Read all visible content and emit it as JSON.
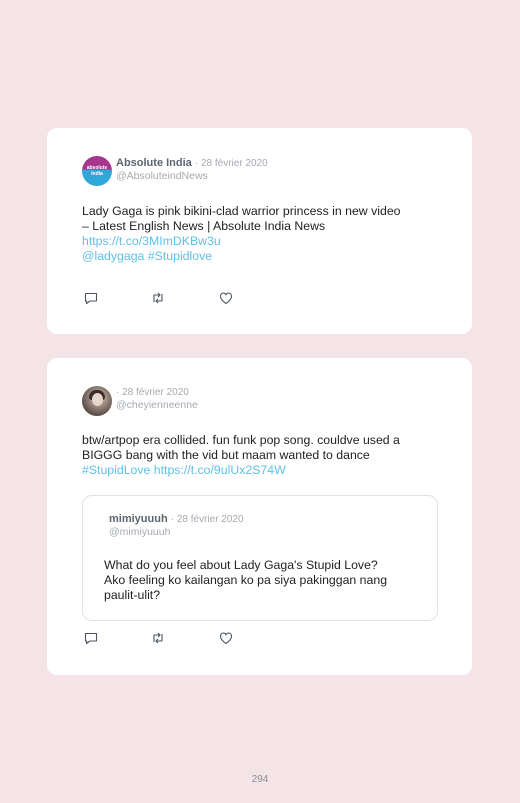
{
  "tweets": [
    {
      "author_name": "Absolute India",
      "date": "· 28 février 2020",
      "handle": "@AbsoluteindNews",
      "avatar_text": "absolute india",
      "lines": [
        "Lady Gaga is pink bikini-clad warrior princess in new video",
        "– Latest English News | Absolute India News"
      ],
      "link": "https://t.co/3MImDKBw3u",
      "tags": "@ladygaga #Stupidlove"
    },
    {
      "author_name": "",
      "date": "· 28 février 2020",
      "handle": "@cheyienneenne",
      "lines": [
        "btw/artpop era collided. fun funk pop song. couldve used a",
        "BIGGG bang with the vid but maam wanted to dance"
      ],
      "tags_link": "#StupidLove https://t.co/9ulUx2S74W",
      "quote": {
        "author_name": "mimiyuuuh",
        "date": "· 28 février 2020",
        "handle": "@mimiyuuuh",
        "lines": [
          "What do you feel about Lady Gaga's Stupid Love?",
          "Ako feeling ko kailangan ko pa siya pakinggan nang",
          "paulit-ulit?"
        ]
      }
    }
  ],
  "icons": {
    "reply": "reply-icon",
    "retweet": "retweet-icon",
    "like": "heart-icon"
  },
  "colors": {
    "background": "#f4e4e8",
    "link": "#5fc0e8",
    "card": "#ffffff"
  },
  "page_number": "294"
}
